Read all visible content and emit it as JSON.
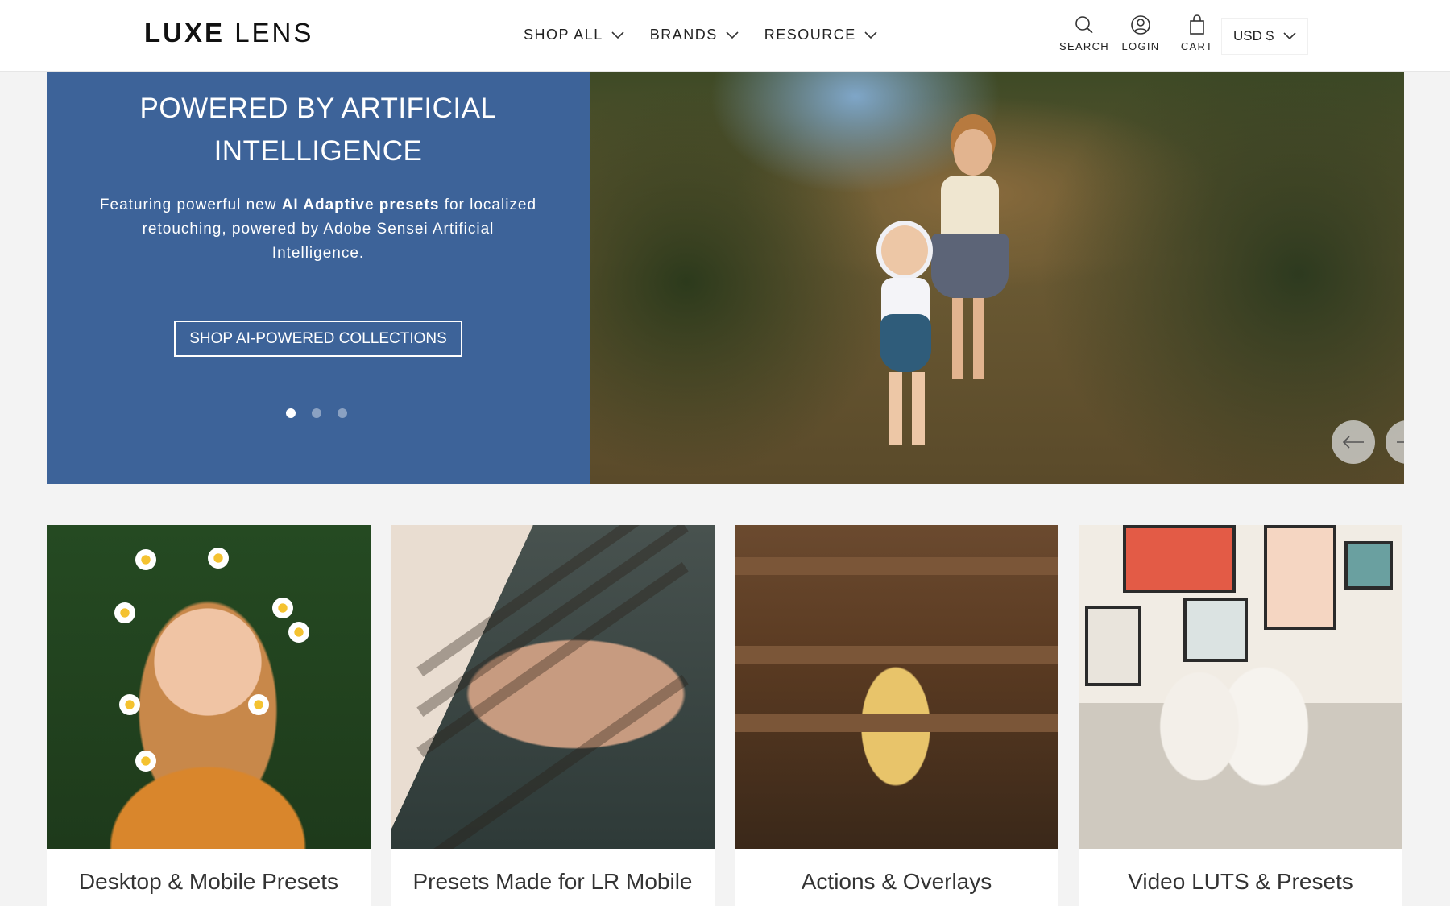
{
  "header": {
    "logo_bold": "LUXE",
    "logo_light": "LENS",
    "nav": [
      {
        "label": "SHOP ALL"
      },
      {
        "label": "BRANDS"
      },
      {
        "label": "RESOURCE"
      }
    ],
    "utilities": {
      "search": "SEARCH",
      "login": "LOGIN",
      "cart": "CART"
    },
    "currency": "USD $"
  },
  "hero": {
    "title": "POWERED BY ARTIFICIAL INTELLIGENCE",
    "desc_pre": "Featuring powerful new ",
    "desc_bold": "AI Adaptive presets",
    "desc_post": " for localized retouching, powered by Adobe Sensei Artificial Intelligence.",
    "cta": "SHOP AI-POWERED COLLECTIONS",
    "slides": {
      "count": 3,
      "active": 1
    },
    "colors": {
      "panel": "#3d6399"
    }
  },
  "collections": [
    {
      "label": "Desktop & Mobile Presets"
    },
    {
      "label": "Presets Made for LR Mobile"
    },
    {
      "label": "Actions & Overlays"
    },
    {
      "label": "Video LUTS & Presets"
    }
  ]
}
